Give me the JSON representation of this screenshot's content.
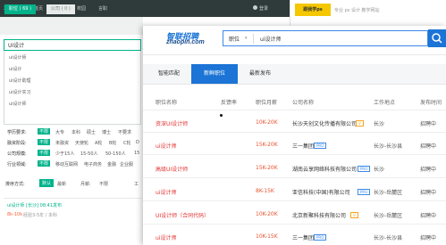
{
  "lagou": {
    "logo": "拉勾",
    "nav": [
      "首页",
      "公司",
      "校园",
      "言职"
    ],
    "login": "登录",
    "tabs": [
      "职位 ( 69 )",
      "公司 ( 0 )"
    ],
    "search_value": "UI设计",
    "suggestions": [
      "ui设计师",
      "ui设计",
      "ui设计助理",
      "ui设计实习",
      "ui设计师"
    ],
    "filters": [
      {
        "label": "学历要求:",
        "selected": "不限",
        "options": [
          "大专",
          "本科",
          "硕士",
          "博士",
          "不要求"
        ]
      },
      {
        "label": "融资阶段:",
        "selected": "不限",
        "options": [
          "未融资",
          "天使轮",
          "A轮",
          "B轮",
          "C轮",
          "D"
        ]
      },
      {
        "label": "公司规模:",
        "selected": "不限",
        "options": [
          "少于15人",
          "15-50人",
          "50-150人",
          "15"
        ]
      },
      {
        "label": "行业领域:",
        "selected": "不限",
        "options": [
          "移动互联网",
          "电子商务",
          "金融",
          "企业服"
        ]
      }
    ],
    "sort": {
      "label": "排序方式:",
      "default": "默认",
      "latest": "最新",
      "month": "月薪:",
      "limit": "不限",
      "work": "工"
    },
    "card": {
      "title": "ui设计师 [长沙]  08:41发布",
      "salary": "8k-10k",
      "requirement": "经验3-5年 / 本科"
    }
  },
  "ad": {
    "box_text": "跟我学ps",
    "text": "专业 ps 设计 教学网站"
  },
  "zhaopin": {
    "logo": "智联招聘",
    "domain": "zhaopin.com",
    "search_type": "职位",
    "search_query": "ui设计师",
    "tabs": [
      "智能匹配",
      "新鲜职位",
      "最新发布"
    ],
    "headers": [
      "职位名称",
      "反馈率",
      "职位月薪",
      "公司名称",
      "工作地点",
      "发布时间"
    ],
    "rows": [
      {
        "title": "资深UI设计师",
        "salary": "10K-20K",
        "company": "长沙天创文化传播有限公司",
        "badge": "V",
        "badge_type": "v",
        "location": "长沙",
        "date": "招聘中"
      },
      {
        "title": "ui设计师",
        "salary": "15K-20K",
        "company": "三一集团",
        "badge": "PRO",
        "badge_type": "p",
        "location": "长沙-长沙县",
        "date": "招聘中"
      },
      {
        "title": "高级UI设计师",
        "salary": "15K-20K",
        "company": "湖南云享网络科技有限公司",
        "badge": "PRO",
        "badge_type": "p",
        "location": "长沙",
        "date": "招聘中"
      },
      {
        "title": "ui设计师",
        "salary": "8K-15K",
        "company": "亚信科技(中国)有限公司",
        "badge": "PRO",
        "badge_type": "p",
        "location": "长沙-岳麓区",
        "date": "招聘中"
      },
      {
        "title": "UI设计师（合同代码）",
        "salary": "10K-20K",
        "company": "北京新聚科技有限公司",
        "badge": "V",
        "badge_type": "v",
        "location": "长沙-岳麓区",
        "date": "招聘中"
      },
      {
        "title": "ui设计师",
        "salary": "10K-15K",
        "company": "三一集团",
        "badge": "PRO",
        "badge_type": "p",
        "location": "长沙-长沙县",
        "date": "招聘中"
      }
    ]
  }
}
